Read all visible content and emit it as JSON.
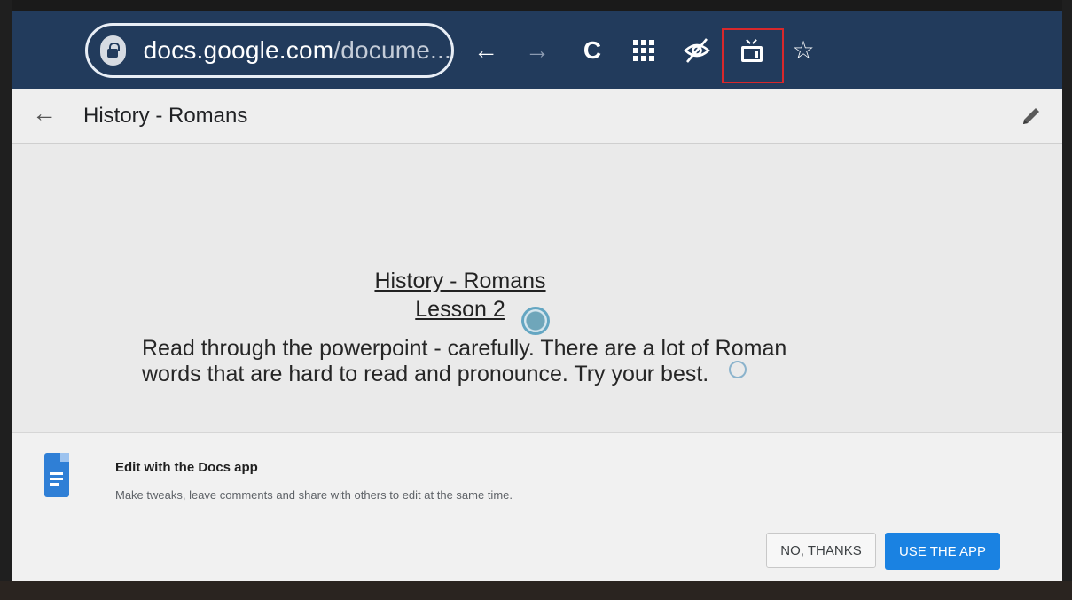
{
  "browser": {
    "url_main": "docs.google.com",
    "url_rest": "/docume...",
    "icons": [
      "lock-icon",
      "back-arrow-icon",
      "forward-arrow-icon",
      "reload-icon",
      "apps-grid-icon",
      "eye-off-icon",
      "tv-icon",
      "star-icon"
    ],
    "glyphs": {
      "back": "←",
      "forward": "→",
      "reload": "C",
      "star": "☆",
      "eye_off": "⊘"
    },
    "highlight_color": "#d8282b"
  },
  "doc": {
    "header_title": "History - Romans",
    "back_glyph": "←",
    "heading_line1": "History - Romans",
    "heading_line2": "Lesson 2",
    "paragraph": "Read through the powerpoint - carefully. There are a lot of Roman words that are hard to read and pronounce. Try your best."
  },
  "banner": {
    "title": "Edit with the Docs app",
    "subtitle": "Make tweaks, leave comments and share with others to edit at the same time.",
    "no_label": "NO, THANKS",
    "use_label": "USE THE APP",
    "accent": "#1a82e2"
  }
}
